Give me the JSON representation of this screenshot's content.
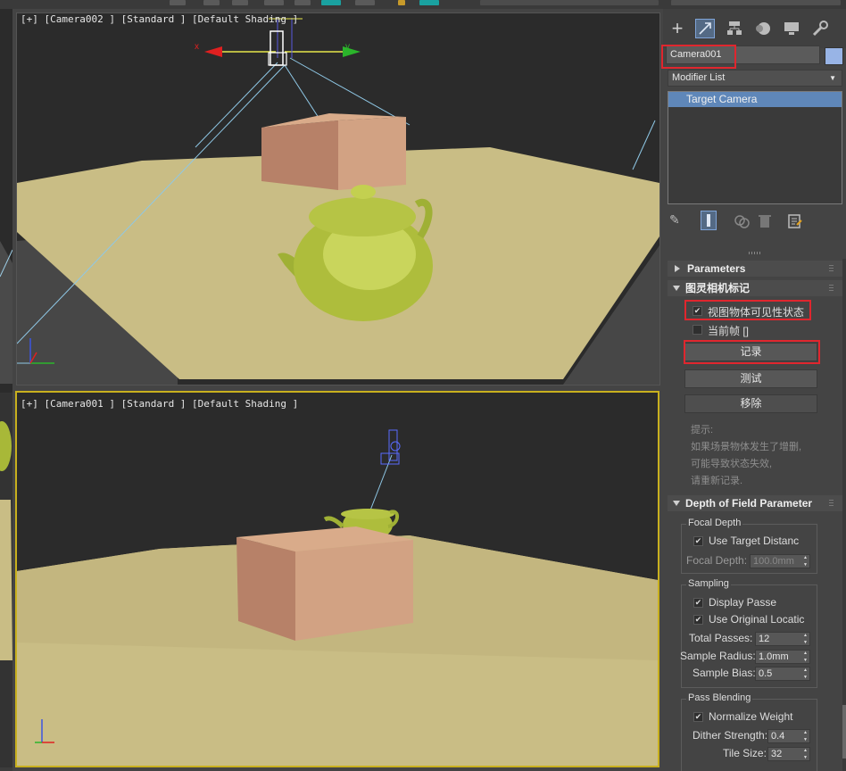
{
  "viewport_top": {
    "label": "[+] [Camera002 ] [Standard ] [Default Shading ]"
  },
  "viewport_bottom": {
    "label": "[+] [Camera001 ] [Standard ] [Default Shading ]"
  },
  "axis_labels": {
    "x": "x",
    "y": "y"
  },
  "panel": {
    "object_name": "Camera001",
    "modifier_list": "Modifier List",
    "stack_item": "Target Camera",
    "rollouts": {
      "parameters": "Parameters",
      "snapshot": {
        "title": "图灵相机标记",
        "visibility_checkbox": "视图物体可见性状态",
        "current_frame_checkbox": "当前帧 []",
        "record_button": "记录",
        "test_button": "测试",
        "remove_button": "移除",
        "hint_title": "提示:",
        "hint_line1": "如果场景物体发生了增删,",
        "hint_line2": "可能导致状态失效,",
        "hint_line3": "请重新记录."
      },
      "dof": {
        "title": "Depth of Field Parameter",
        "focal_group": "Focal Depth",
        "use_target": "Use Target Distanc",
        "focal_label": "Focal Depth:",
        "focal_value": "100.0mm",
        "sampling_group": "Sampling",
        "display_passes": "Display Passe",
        "use_original": "Use Original Locatic",
        "total_passes_label": "Total Passes:",
        "total_passes_value": "12",
        "sample_radius_label": "Sample Radius:",
        "sample_radius_value": "1.0mm",
        "sample_bias_label": "Sample Bias:",
        "sample_bias_value": "0.5",
        "blend_group": "Pass Blending",
        "normalize": "Normalize Weight",
        "dither_label": "Dither Strength:",
        "dither_value": "0.4",
        "tile_label": "Tile Size:",
        "tile_value": "32"
      }
    }
  },
  "colors": {
    "highlight": "#e0262e",
    "selection": "#5f87b9",
    "viewport_bg": "#2b2b2b",
    "ground": "#c9bd85",
    "box": "#c9967b",
    "teapot": "#a8b838",
    "active_border": "#c8b01e"
  }
}
